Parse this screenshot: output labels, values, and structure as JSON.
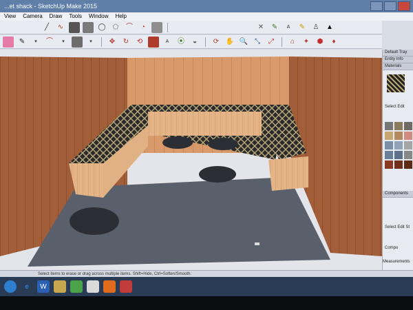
{
  "window": {
    "title": "...et shack - SketchUp Make 2015"
  },
  "menu": {
    "items": [
      "View",
      "Camera",
      "Draw",
      "Tools",
      "Window",
      "Help"
    ]
  },
  "tray": {
    "title": "Default Tray",
    "panels": [
      "Entity Info",
      "Materials"
    ],
    "mat_tabs": [
      "Select",
      "Edit"
    ],
    "components": "Components",
    "comp_tabs": [
      "Select",
      "Edit",
      "St"
    ],
    "comp_label": "Compo",
    "measurements": "Measurements"
  },
  "status": {
    "text": "Select items to erase or drag across multiple items. Shift=Hide, Ctrl=Soften/Smooth."
  },
  "taskbar": {
    "items": [
      "start",
      "ie",
      "word",
      "explorer",
      "chrome",
      "firefox",
      "sketchup"
    ]
  }
}
